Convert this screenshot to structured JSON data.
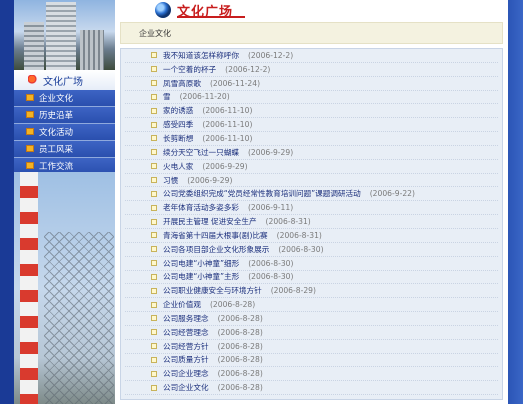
{
  "header": {
    "logo_text": "文化广场"
  },
  "sidebar": {
    "section_title": "文化广场",
    "items": [
      {
        "label": "企业文化"
      },
      {
        "label": "历史沿革"
      },
      {
        "label": "文化活动"
      },
      {
        "label": "员工风采"
      },
      {
        "label": "工作交流"
      }
    ]
  },
  "category_title": "企业文化",
  "articles": [
    {
      "title": "我不知道该怎样称呼你",
      "date": "(2006-12-2)"
    },
    {
      "title": "一个空着的杯子",
      "date": "(2006-12-2)"
    },
    {
      "title": "凤雪高原歌",
      "date": "(2006-11-24)"
    },
    {
      "title": "雪",
      "date": "(2006-11-20)"
    },
    {
      "title": "家的诱惑",
      "date": "(2006-11-10)"
    },
    {
      "title": "感受四季",
      "date": "(2006-11-10)"
    },
    {
      "title": "长剪断想",
      "date": "(2006-11-10)"
    },
    {
      "title": "续分天空飞过一只蝴蝶",
      "date": "(2006-9-29)"
    },
    {
      "title": "火电人家",
      "date": "(2006-9-29)"
    },
    {
      "title": "习惯",
      "date": "(2006-9-29)"
    },
    {
      "title": "公司党委组织完成“党员经常性教育培训问题”课题调研活动",
      "date": "(2006-9-22)"
    },
    {
      "title": "老年体育活动多姿多彩",
      "date": "(2006-9-11)"
    },
    {
      "title": "开展民主管理 促进安全生产",
      "date": "(2006-8-31)"
    },
    {
      "title": "青海省第十四届大根事(剧)比赛",
      "date": "(2006-8-31)"
    },
    {
      "title": "公司各项目部企业文化形象展示",
      "date": "(2006-8-30)"
    },
    {
      "title": "公司电建“小神童”细形",
      "date": "(2006-8-30)"
    },
    {
      "title": "公司电建“小神童”主形",
      "date": "(2006-8-30)"
    },
    {
      "title": "公司职业健康安全与环境方针",
      "date": "(2006-8-29)"
    },
    {
      "title": "企业价值观",
      "date": "(2006-8-28)"
    },
    {
      "title": "公司服务理念",
      "date": "(2006-8-28)"
    },
    {
      "title": "公司经营理念",
      "date": "(2006-8-28)"
    },
    {
      "title": "公司经营方针",
      "date": "(2006-8-28)"
    },
    {
      "title": "公司质量方针",
      "date": "(2006-8-28)"
    },
    {
      "title": "公司企业理念",
      "date": "(2006-8-28)"
    },
    {
      "title": "公司企业文化",
      "date": "(2006-8-28)"
    }
  ],
  "colors": {
    "accent": "#c81e1e",
    "nav_bg": "#2a4fae",
    "link": "#1b2f7c",
    "frame": "#1b3f9a"
  }
}
